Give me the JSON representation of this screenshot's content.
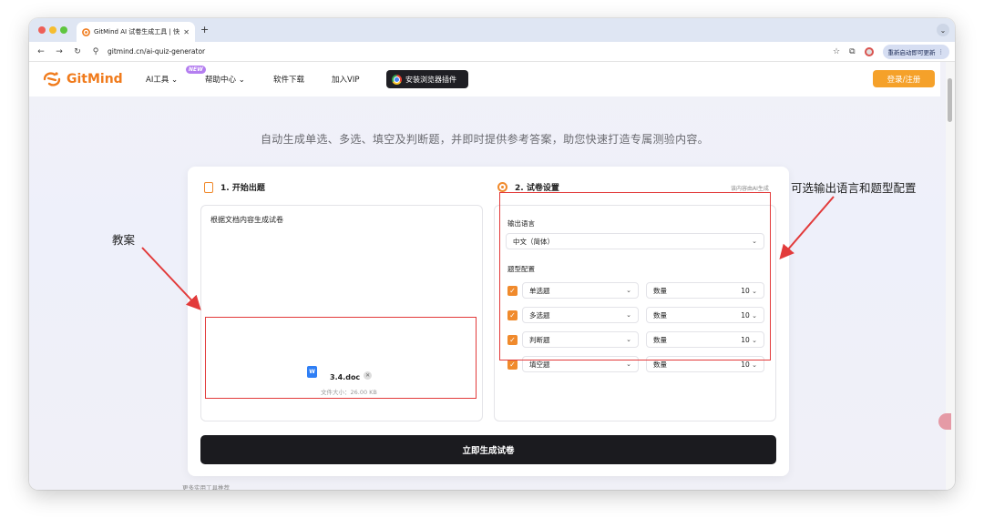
{
  "browser": {
    "tab_title": "GitMind AI 试卷生成工具 | 快...",
    "tab_close": "✕",
    "new_tab": "+",
    "tab_menu": "⌄",
    "url": "gitmind.cn/ai-quiz-generator",
    "relaunch": "重新启动即可更新",
    "icons": [
      "back-icon",
      "forward-icon",
      "reload-icon",
      "site-info-icon",
      "star-icon",
      "extensions-icon",
      "profile-icon",
      "more-icon"
    ]
  },
  "site": {
    "logo_text": "GitMind",
    "nav": {
      "ai_tools": "AI工具",
      "help": "帮助中心",
      "download": "软件下载",
      "vip": "加入VIP",
      "new_badge": "NEW"
    },
    "extension_button": "安装浏览器插件",
    "login": "登录/注册"
  },
  "main": {
    "subtitle": "自动生成单选、多选、填空及判断题，并即时提供参考答案，助您快速打造专属测验内容。",
    "section1": {
      "title": "1. 开始出题",
      "prompt": "根据文档内容生成试卷",
      "file_name": "3.4.doc",
      "file_size": "文件大小：26.00 KB",
      "file_icon_label": "W"
    },
    "section2": {
      "title": "2. 试卷设置",
      "ai_note": "该内容由AI生成",
      "language_label": "输出语言",
      "language_value": "中文（简体）",
      "type_label": "题型配置",
      "qty_label": "数量",
      "types": [
        {
          "name": "单选题",
          "qty": "10",
          "checked": true
        },
        {
          "name": "多选题",
          "qty": "10",
          "checked": true
        },
        {
          "name": "判断题",
          "qty": "10",
          "checked": true
        },
        {
          "name": "填空题",
          "qty": "10",
          "checked": true
        }
      ]
    },
    "generate_button": "立即生成试卷",
    "more_tools": "更多实用工具推荐"
  },
  "annotations": {
    "left": "教案",
    "right": "可选输出语言和题型配置"
  },
  "colors": {
    "accent": "#f08a2c",
    "login": "#f5a12a",
    "annotation_red": "#e23a3a",
    "button_dark": "#1b1b1f"
  }
}
